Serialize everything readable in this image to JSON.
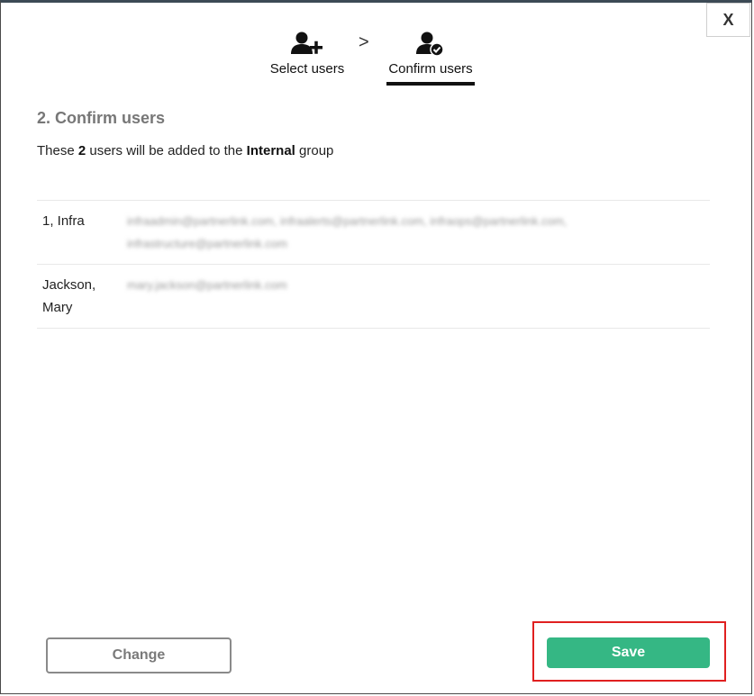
{
  "dialog": {
    "close_label": "X"
  },
  "steps": [
    {
      "label": "Select users",
      "icon": "user-plus-icon"
    },
    {
      "label": "Confirm users",
      "icon": "user-check-icon"
    }
  ],
  "step_separator": ">",
  "confirm": {
    "title": "2. Confirm users",
    "desc_prefix": "These ",
    "count": "2",
    "desc_middle": " users will be added to the ",
    "group": "Internal",
    "desc_suffix": " group"
  },
  "users": [
    {
      "name": "1, Infra",
      "emails": "infraadmin@partnerlink.com, infraalerts@partnerlink.com, infraops@partnerlink.com, infrastructure@partnerlink.com"
    },
    {
      "name": "Jackson, Mary",
      "emails": "mary.jackson@partnerlink.com"
    }
  ],
  "buttons": {
    "change": "Change",
    "save": "Save"
  },
  "colors": {
    "save_bg": "#35b784",
    "highlight": "#e02020"
  }
}
